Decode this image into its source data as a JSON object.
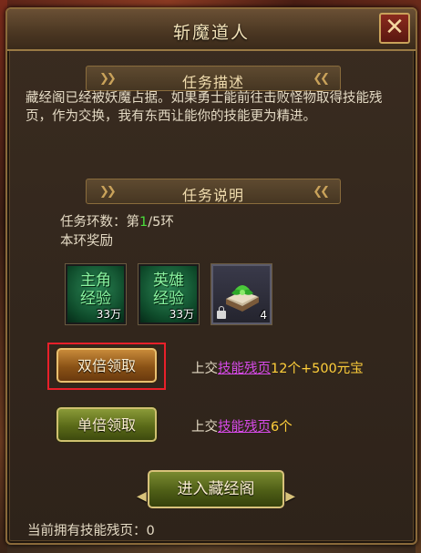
{
  "window": {
    "title": "斩魔道人",
    "close_glyph": "✕"
  },
  "task_description": {
    "header": "任务描述",
    "text": "藏经阁已经被妖魔占据。如果勇士能前往击败怪物取得技能残页，作为交换，我有东西让能你的技能更为精进。"
  },
  "task_explanation": {
    "header": "任务说明",
    "rounds_prefix": "任务环数：第",
    "rounds_current": "1",
    "rounds_suffix": "/5环",
    "reward_label": "本环奖励"
  },
  "rewards": [
    {
      "name": "主角经验",
      "line1": "主角",
      "line2": "经验",
      "count": "33万",
      "icon": "exp-orb-icon"
    },
    {
      "name": "英雄经验",
      "line1": "英雄",
      "line2": "经验",
      "count": "33万",
      "icon": "exp-orb-icon"
    },
    {
      "name": "book",
      "count": "4",
      "icon": "green-book-icon",
      "locked": true
    }
  ],
  "actions": {
    "double_label": "双倍领取",
    "single_label": "单倍领取",
    "double_cost": {
      "prefix": "上交",
      "item": "技能残页",
      "qty": "12个+500元宝"
    },
    "single_cost": {
      "prefix": "上交",
      "item": "技能残页",
      "qty": "6个"
    },
    "enter_label": "进入藏经阁"
  },
  "status": {
    "owned_text": "当前拥有技能残页：0"
  },
  "colors": {
    "highlight": "#e8202a",
    "round_number": "#4ade3a",
    "item_link": "#d64ae8",
    "cost_qty": "#ffcf3a"
  }
}
